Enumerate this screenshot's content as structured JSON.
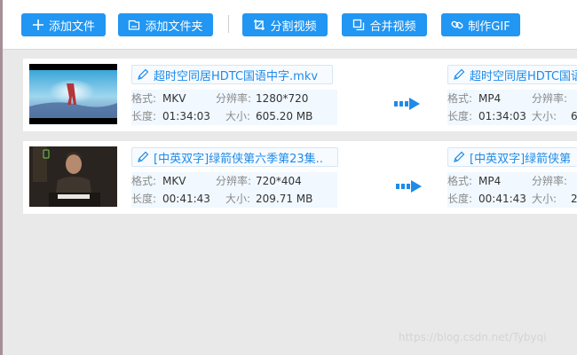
{
  "toolbar": {
    "add_file": "添加文件",
    "add_folder": "添加文件夹",
    "split_video": "分割视频",
    "merge_video": "合并视频",
    "make_gif": "制作GIF"
  },
  "labels": {
    "format": "格式:",
    "resolution": "分辨率:",
    "duration": "长度:",
    "size": "大小:"
  },
  "tasks": [
    {
      "source": {
        "name": "超时空同居HDTC国语中字.mkv",
        "format": "MKV",
        "resolution": "1280*720",
        "duration": "01:34:03",
        "size": "605.20 MB"
      },
      "output": {
        "name": "超时空同居HDTC国语中字",
        "format": "MP4",
        "resolution_partial": "",
        "duration": "01:34:03",
        "size_partial": "6"
      }
    },
    {
      "source": {
        "name": "[中英双字]绿箭侠第六季第23集..",
        "format": "MKV",
        "resolution": "720*404",
        "duration": "00:41:43",
        "size": "209.71 MB"
      },
      "output": {
        "name": "[中英双字]绿箭侠第",
        "format": "MP4",
        "resolution_partial": "",
        "duration": "00:41:43",
        "size_partial": "2"
      }
    }
  ],
  "watermark": "https://blog.csdn.net/Tybyqi",
  "colors": {
    "accent": "#2196f3",
    "link": "#1f8be8",
    "info_bg": "#f1f8ff"
  }
}
